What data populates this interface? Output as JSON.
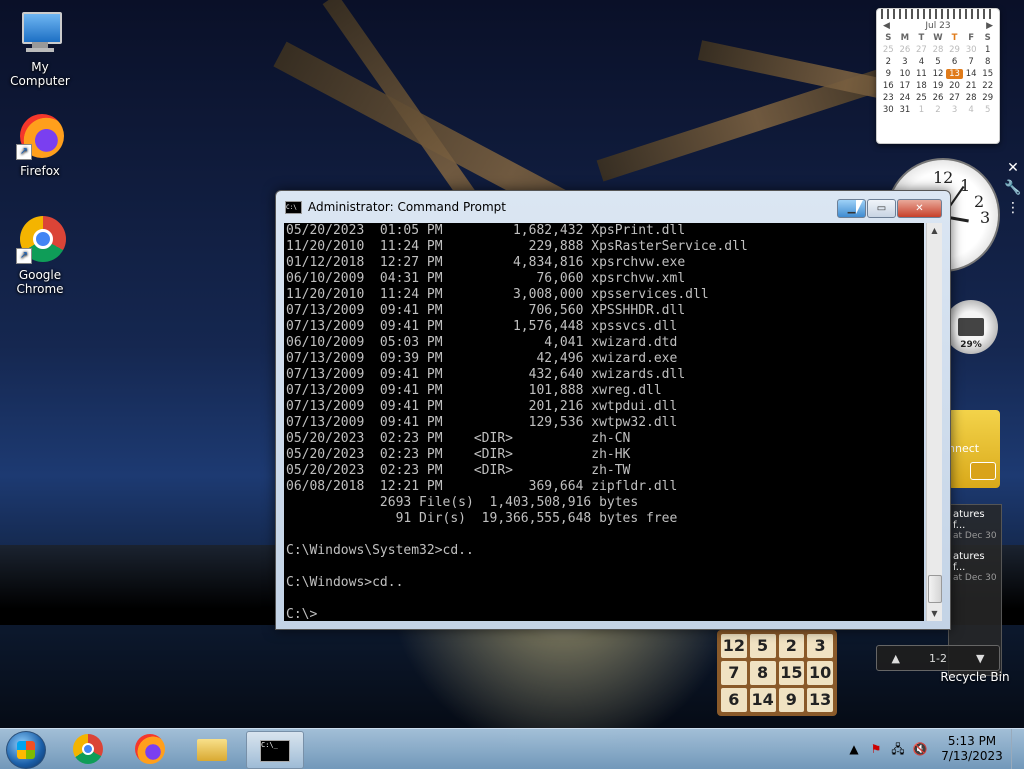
{
  "desktop": {
    "icons": [
      {
        "label": "My Computer"
      },
      {
        "label": "Firefox"
      },
      {
        "label": "Google\nChrome"
      }
    ],
    "recycle_bin": "Recycle Bin"
  },
  "calendar": {
    "month": "Jul 23",
    "day_headers": [
      "S",
      "M",
      "T",
      "W",
      "T",
      "F",
      "S"
    ],
    "days": [
      "25",
      "26",
      "27",
      "28",
      "29",
      "30",
      "1",
      "2",
      "3",
      "4",
      "5",
      "6",
      "7",
      "8",
      "9",
      "10",
      "11",
      "12",
      "13",
      "14",
      "15",
      "16",
      "17",
      "18",
      "19",
      "20",
      "21",
      "22",
      "23",
      "24",
      "25",
      "26",
      "27",
      "28",
      "29",
      "30",
      "31",
      "1",
      "2",
      "3",
      "4",
      "5"
    ],
    "today": "13"
  },
  "clock_gadget": {
    "numbers": [
      "12",
      "1",
      "2",
      "3"
    ]
  },
  "cpu_meter": {
    "value": "29%"
  },
  "connect_tile": {
    "label": "nnect"
  },
  "feed": {
    "items": [
      {
        "title": "atures f...",
        "sub": "at Dec 30"
      },
      {
        "title": "atures f...",
        "sub": "at Dec 30"
      }
    ],
    "page": "1-2"
  },
  "puzzle": {
    "tiles": [
      "12",
      "5",
      "2",
      "3",
      "7",
      "8",
      "15",
      "10",
      "6",
      "14",
      "9",
      "13"
    ]
  },
  "window": {
    "title": "Administrator:  Command Prompt",
    "lines": [
      "05/20/2023  01:05 PM         1,682,432 XpsPrint.dll",
      "11/20/2010  11:24 PM           229,888 XpsRasterService.dll",
      "01/12/2018  12:27 PM         4,834,816 xpsrchvw.exe",
      "06/10/2009  04:31 PM            76,060 xpsrchvw.xml",
      "11/20/2010  11:24 PM         3,008,000 xpsservices.dll",
      "07/13/2009  09:41 PM           706,560 XPSSHHDR.dll",
      "07/13/2009  09:41 PM         1,576,448 xpssvcs.dll",
      "06/10/2009  05:03 PM             4,041 xwizard.dtd",
      "07/13/2009  09:39 PM            42,496 xwizard.exe",
      "07/13/2009  09:41 PM           432,640 xwizards.dll",
      "07/13/2009  09:41 PM           101,888 xwreg.dll",
      "07/13/2009  09:41 PM           201,216 xwtpdui.dll",
      "07/13/2009  09:41 PM           129,536 xwtpw32.dll",
      "05/20/2023  02:23 PM    <DIR>          zh-CN",
      "05/20/2023  02:23 PM    <DIR>          zh-HK",
      "05/20/2023  02:23 PM    <DIR>          zh-TW",
      "06/08/2018  12:21 PM           369,664 zipfldr.dll",
      "            2693 File(s)  1,403,508,916 bytes",
      "              91 Dir(s)  19,366,555,648 bytes free",
      "",
      "C:\\Windows\\System32>cd..",
      "",
      "C:\\Windows>cd..",
      "",
      "C:\\>"
    ]
  },
  "taskbar": {
    "time": "5:13 PM",
    "date": "7/13/2023"
  }
}
